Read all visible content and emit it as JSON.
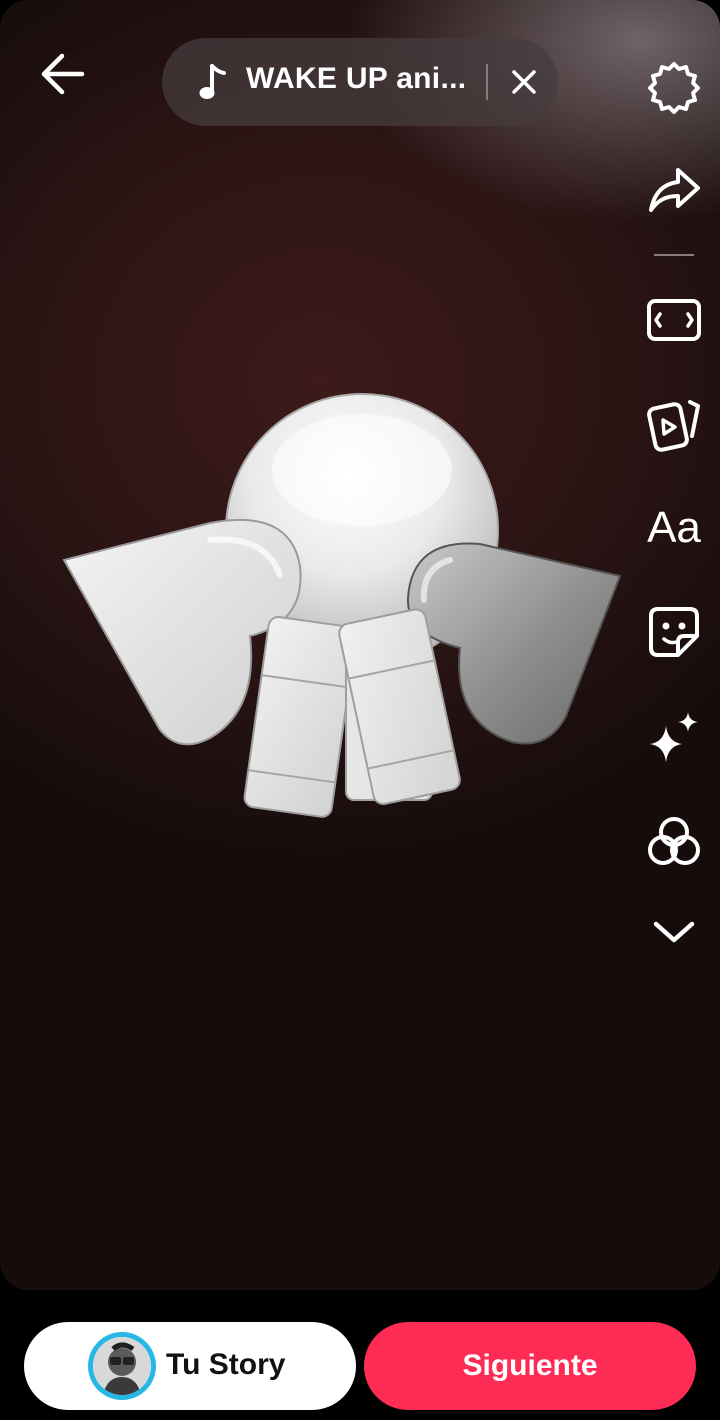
{
  "music": {
    "title": "WAKE UP ani...",
    "icon": "music-note-icon"
  },
  "toolbar": {
    "icons": [
      "settings-gear-icon",
      "share-arrow-icon",
      "aspect-ratio-icon",
      "video-templates-icon",
      "text-icon",
      "sticker-icon",
      "effects-sparkle-icon",
      "filters-icon",
      "more-chevron-icon"
    ],
    "text_label": "Aa"
  },
  "bottom": {
    "story_label": "Tu Story",
    "next_label": "Siguiente"
  },
  "colors": {
    "accent": "#fe2c55",
    "avatar_ring": "#25b8e6",
    "background": "#2a1414"
  }
}
